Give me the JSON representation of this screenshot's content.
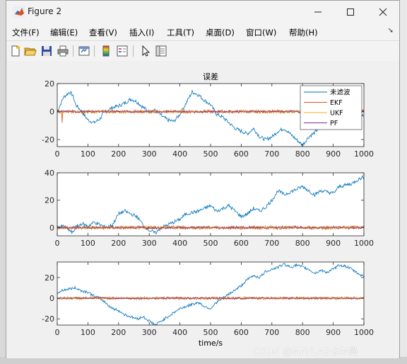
{
  "window": {
    "title": "Figure 2",
    "menus": [
      "文件(F)",
      "编辑(E)",
      "查看(V)",
      "插入(I)",
      "工具(T)",
      "桌面(D)",
      "窗口(W)",
      "帮助(H)"
    ]
  },
  "toolbar": {
    "buttons": [
      "new-figure-icon",
      "open-file-icon",
      "save-icon",
      "print-icon",
      "link-icon",
      "colorbar-icon",
      "legend-icon",
      "pointer-icon",
      "property-editor-icon"
    ]
  },
  "watermark": "CSDN @MATLAB卡尔曼",
  "colors": {
    "raw": "#0072BD",
    "ekf": "#D95319",
    "ukf": "#EDB120",
    "pf": "#7E2F8E"
  },
  "chart_data": [
    {
      "type": "line",
      "title": "误差",
      "xlabel": "",
      "ylabel": "",
      "xlim": [
        0,
        1000
      ],
      "ylim": [
        -25,
        20
      ],
      "xticks": [
        0,
        100,
        200,
        300,
        400,
        500,
        600,
        700,
        800,
        900,
        1000
      ],
      "yticks": [
        -20,
        0,
        20
      ],
      "legend": {
        "position": "top-right",
        "entries": [
          "未滤波",
          "EKF",
          "UKF",
          "PF"
        ]
      },
      "series": [
        {
          "name": "未滤波",
          "x": [
            0,
            20,
            40,
            50,
            60,
            80,
            100,
            120,
            140,
            150,
            160,
            180,
            200,
            220,
            240,
            260,
            280,
            300,
            320,
            340,
            360,
            380,
            400,
            420,
            440,
            460,
            480,
            500,
            520,
            540,
            560,
            580,
            600,
            620,
            640,
            660,
            680,
            700,
            720,
            740,
            760,
            780,
            800,
            820,
            840,
            860,
            880,
            900,
            920,
            940,
            960,
            980,
            1000
          ],
          "y": [
            0,
            10,
            14,
            12,
            5,
            0,
            -6,
            -8,
            -5,
            -1,
            0,
            3,
            4,
            6,
            9,
            7,
            3,
            0,
            1,
            -3,
            -6,
            -7,
            -2,
            6,
            14,
            12,
            8,
            5,
            -2,
            -4,
            -8,
            -12,
            -14,
            -16,
            -12,
            -18,
            -20,
            -18,
            -14,
            -12,
            -16,
            -20,
            -24,
            -18,
            -15,
            -10,
            -12,
            -7,
            -9,
            -4,
            -6,
            -2,
            -3
          ]
        },
        {
          "name": "EKF",
          "amplitude": 1.2,
          "spike_at": 16,
          "spike_value": -8
        },
        {
          "name": "UKF",
          "amplitude": 1.0
        },
        {
          "name": "PF",
          "amplitude": 0.6
        }
      ]
    },
    {
      "type": "line",
      "title": "",
      "xlabel": "",
      "ylabel": "",
      "xlim": [
        0,
        1000
      ],
      "ylim": [
        -6,
        40
      ],
      "xticks": [
        0,
        100,
        200,
        300,
        400,
        500,
        600,
        700,
        800,
        900,
        1000
      ],
      "yticks": [
        0,
        20,
        40
      ],
      "series": [
        {
          "name": "未滤波",
          "x": [
            0,
            20,
            40,
            50,
            60,
            80,
            100,
            120,
            140,
            160,
            180,
            200,
            220,
            240,
            260,
            280,
            300,
            320,
            340,
            360,
            380,
            400,
            420,
            440,
            460,
            480,
            500,
            520,
            540,
            560,
            580,
            600,
            620,
            640,
            660,
            680,
            700,
            720,
            740,
            760,
            780,
            800,
            820,
            840,
            860,
            880,
            900,
            920,
            940,
            960,
            980,
            1000
          ],
          "y": [
            0,
            1,
            -2,
            -4,
            0,
            3,
            1,
            4,
            2,
            0,
            2,
            10,
            12,
            10,
            8,
            2,
            -2,
            -4,
            0,
            2,
            4,
            6,
            10,
            11,
            12,
            14,
            16,
            12,
            14,
            16,
            12,
            8,
            10,
            14,
            12,
            15,
            20,
            27,
            24,
            26,
            28,
            30,
            27,
            24,
            27,
            26,
            25,
            30,
            31,
            32,
            35,
            37
          ]
        },
        {
          "name": "EKF",
          "amplitude": 1.3
        },
        {
          "name": "UKF",
          "amplitude": 1.1
        },
        {
          "name": "PF",
          "amplitude": 0.7
        }
      ]
    },
    {
      "type": "line",
      "title": "",
      "xlabel": "time/s",
      "ylabel": "",
      "xlim": [
        0,
        1000
      ],
      "ylim": [
        -26,
        35
      ],
      "xticks": [
        0,
        100,
        200,
        300,
        400,
        500,
        600,
        700,
        800,
        900,
        1000
      ],
      "yticks": [
        -20,
        0,
        20
      ],
      "series": [
        {
          "name": "未滤波",
          "x": [
            0,
            20,
            40,
            60,
            80,
            100,
            120,
            140,
            160,
            180,
            200,
            220,
            240,
            260,
            280,
            300,
            320,
            340,
            360,
            380,
            400,
            420,
            440,
            460,
            480,
            500,
            520,
            540,
            560,
            580,
            600,
            620,
            640,
            660,
            680,
            700,
            720,
            740,
            760,
            780,
            800,
            820,
            840,
            860,
            880,
            900,
            920,
            940,
            960,
            980,
            1000
          ],
          "y": [
            5,
            8,
            9,
            10,
            7,
            6,
            2,
            0,
            -5,
            -10,
            -12,
            -16,
            -18,
            -20,
            -18,
            -22,
            -26,
            -22,
            -18,
            -14,
            -10,
            -8,
            -6,
            -4,
            -8,
            -10,
            -4,
            0,
            4,
            8,
            12,
            18,
            22,
            20,
            26,
            28,
            30,
            33,
            30,
            32,
            30,
            28,
            24,
            27,
            25,
            28,
            32,
            31,
            28,
            24,
            21
          ]
        },
        {
          "name": "EKF",
          "amplitude": 1.3
        },
        {
          "name": "UKF",
          "amplitude": 1.1
        },
        {
          "name": "PF",
          "amplitude": 0.7
        }
      ]
    }
  ]
}
